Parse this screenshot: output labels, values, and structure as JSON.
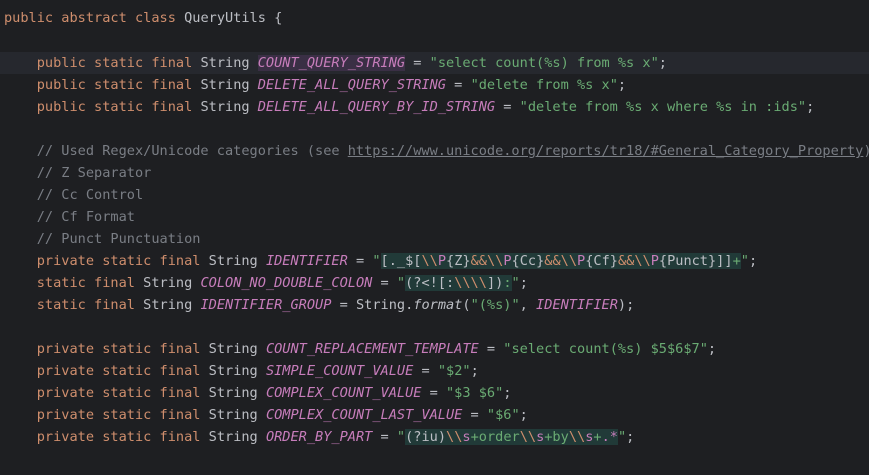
{
  "editor": {
    "class_decl": {
      "public": "public",
      "abstract": "abstract",
      "class": "class",
      "name": "QueryUtils",
      "brace": " {"
    },
    "kw": {
      "public": "public",
      "private": "private",
      "static": "static",
      "final": "final",
      "type": "String"
    },
    "fields": {
      "count_query": {
        "name": "COUNT_QUERY_STRING",
        "value": "\"select count(%s) from %s x\""
      },
      "delete_all": {
        "name": "DELETE_ALL_QUERY_STRING",
        "value": "\"delete from %s x\""
      },
      "delete_by_id": {
        "name": "DELETE_ALL_QUERY_BY_ID_STRING",
        "value": "\"delete from %s x where %s in :ids\""
      },
      "identifier": {
        "name": "IDENTIFIER"
      },
      "colon": {
        "name": "COLON_NO_DOUBLE_COLON"
      },
      "identifier_group": {
        "name": "IDENTIFIER_GROUP",
        "format_call": "format",
        "string_class": "String",
        "fmt": "\"(%s)\""
      },
      "count_template": {
        "name": "COUNT_REPLACEMENT_TEMPLATE",
        "value": "\"select count(%s) $5$6$7\""
      },
      "simple_count": {
        "name": "SIMPLE_COUNT_VALUE",
        "value": "\"$2\""
      },
      "complex_count": {
        "name": "COMPLEX_COUNT_VALUE",
        "value": "\"$3 $6\""
      },
      "complex_count_last": {
        "name": "COMPLEX_COUNT_LAST_VALUE",
        "value": "\"$6\""
      },
      "order_by": {
        "name": "ORDER_BY_PART"
      }
    },
    "comments": {
      "regex_pre": "// Used Regex/Unicode categories (see ",
      "regex_link": "https://www.unicode.org/reports/tr18/#General_Category_Property",
      "regex_post": "):",
      "z": "// Z Separator",
      "cc": "// Cc Control",
      "cf": "// Cf Format",
      "punct": "// Punct Punctuation"
    }
  }
}
